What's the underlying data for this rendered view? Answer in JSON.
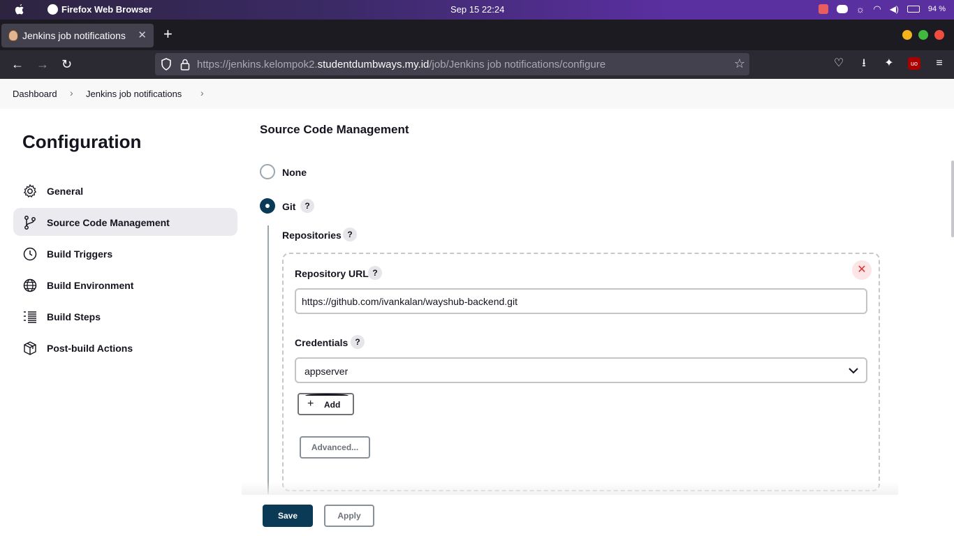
{
  "os": {
    "app_name": "Firefox Web Browser",
    "clock": "Sep 15  22:24",
    "battery": "94 %"
  },
  "browser": {
    "tab_title": "Jenkins job notifications",
    "url_prefix": "https://jenkins.kelompok2.",
    "url_domain": "studentdumbways.my.id",
    "url_suffix": "/job/Jenkins job notifications/configure"
  },
  "breadcrumb": {
    "items": [
      "Dashboard",
      "Jenkins job notifications"
    ]
  },
  "sidebar": {
    "title": "Configuration",
    "items": [
      {
        "label": "General",
        "icon": "gear-icon"
      },
      {
        "label": "Source Code Management",
        "icon": "branch-icon",
        "active": true
      },
      {
        "label": "Build Triggers",
        "icon": "timer-icon"
      },
      {
        "label": "Build Environment",
        "icon": "globe-icon"
      },
      {
        "label": "Build Steps",
        "icon": "list-icon"
      },
      {
        "label": "Post-build Actions",
        "icon": "package-icon"
      }
    ]
  },
  "scm": {
    "section_title": "Source Code Management",
    "options": [
      {
        "label": "None",
        "selected": false
      },
      {
        "label": "Git",
        "selected": true
      }
    ],
    "help": "?",
    "repositories_label": "Repositories",
    "repo_url_label": "Repository URL",
    "repo_url_value": "https://github.com/ivankalan/wayshub-backend.git",
    "credentials_label": "Credentials",
    "credentials_value": "appserver",
    "add_label": "Add",
    "advanced_label": "Advanced..."
  },
  "actions": {
    "save": "Save",
    "apply": "Apply"
  },
  "colors": {
    "primary": "#0b3a57",
    "danger": "#e2312f",
    "os_bar": "#3b2a66"
  }
}
